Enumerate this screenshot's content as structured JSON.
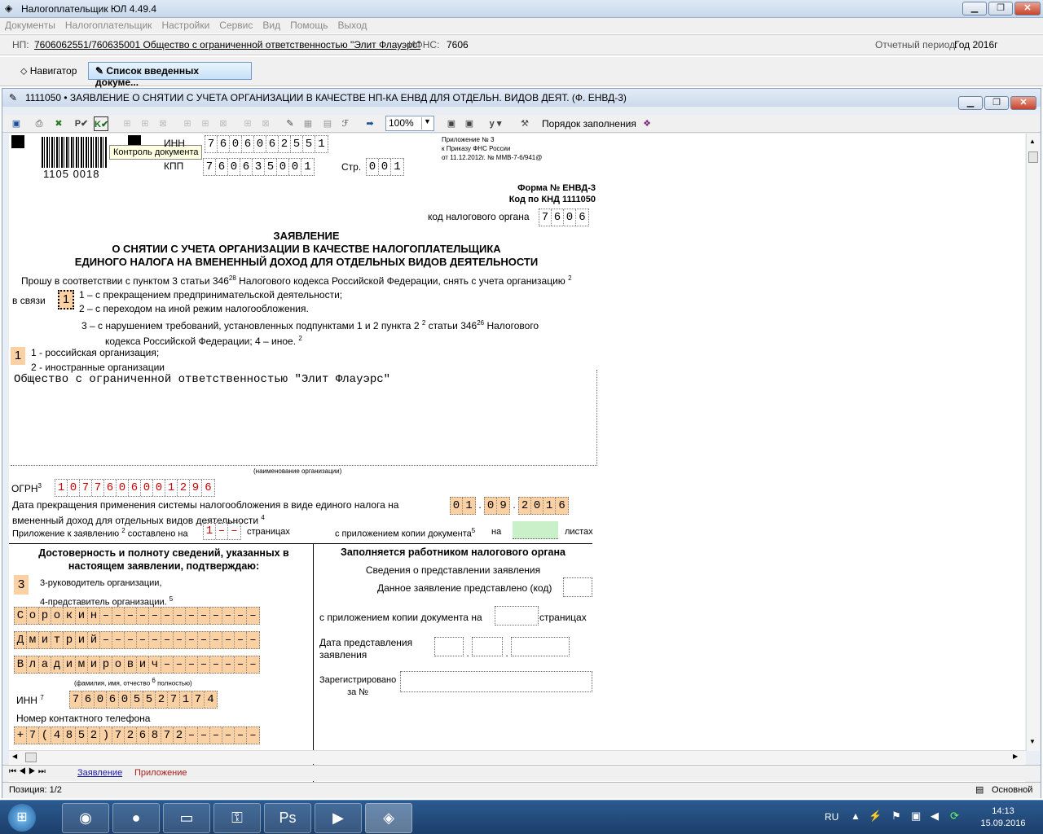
{
  "app": {
    "title": "Налогоплательщик ЮЛ 4.49.4"
  },
  "menu": [
    "Документы",
    "Налогоплательщик",
    "Настройки",
    "Сервис",
    "Вид",
    "Помощь",
    "Выход"
  ],
  "np": {
    "label": "НП:",
    "value": "7606062551/760635001 Общество с ограниченной ответственностью \"Элит Флауэрс\"",
    "ifns_label": "ИФНС:",
    "ifns_value": "7606",
    "period_label": "Отчетный период:",
    "period_value": "Год  2016г"
  },
  "tabs": {
    "navigator": "Навигатор",
    "list": "Список введенных докуме..."
  },
  "doc": {
    "title": "1111050 • ЗАЯВЛЕНИЕ О СНЯТИИ С УЧЕТА ОРГАНИЗАЦИИ В КАЧЕСТВЕ НП-КА ЕНВД ДЛЯ ОТДЕЛЬН. ВИДОВ ДЕЯТ. (Ф. ЕНВД-3)"
  },
  "toolbar": {
    "zoom": "100%",
    "order": "Порядок заполнения",
    "tooltip": "Контроль документа"
  },
  "form": {
    "barcode": "1105 0018",
    "inn_label": "ИНН",
    "inn": [
      "7",
      "6",
      "0",
      "6",
      "0",
      "6",
      "2",
      "5",
      "5",
      "1"
    ],
    "kpp_label": "КПП",
    "kpp": [
      "7",
      "6",
      "0",
      "6",
      "3",
      "5",
      "0",
      "0",
      "1"
    ],
    "page_label": "Стр.",
    "page": [
      "0",
      "0",
      "1"
    ],
    "annex1": "Приложение № 3",
    "annex2": "к Приказу ФНС России",
    "annex3": "от 11.12.2012г. № ММВ-7-6/941@",
    "form_no": "Форма № ЕНВД-3",
    "knd": "Код по КНД 1111050",
    "tax_code_label": "код налогового органа",
    "tax_code": [
      "7",
      "6",
      "0",
      "6"
    ],
    "h1": "ЗАЯВЛЕНИЕ",
    "h2": "О СНЯТИИ С УЧЕТА ОРГАНИЗАЦИИ В КАЧЕСТВЕ НАЛОГОПЛАТЕЛЬЩИКА",
    "h3": "ЕДИНОГО НАЛОГА НА ВМЕНЕННЫЙ ДОХОД ДЛЯ ОТДЕЛЬНЫХ ВИДОВ ДЕЯТЕЛЬНОСТИ",
    "ask": "Прошу в соответствии с пунктом 3 статьи 346",
    "ask_sup": "28",
    "ask2": "Налогового кодекса Российской Федерации, снять с учета организацию",
    "ask_sup2": "2",
    "reason_label": "в связи",
    "reason_value": "1",
    "r1": "1 – с прекращением предпринимательской деятельности;",
    "r2": "2 – с переходом на иной режим налогообложения.",
    "r3": "3 – с нарушением требований, установленных подпунктами 1 и 2 пункта 2",
    "r3_sup": "2",
    "r3b": "статьи 346",
    "r3b_sup": "26",
    "r3c": "Налогового",
    "r4": "кодекса Российской Федерации; 4 – иное.",
    "r4_sup": "2",
    "org_type": "1",
    "o1": "1 - российская организация;",
    "o2": "2 - иностранные организации",
    "org_name": "Общество с ограниченной ответственностью \"Элит Флауэрс\"",
    "org_caption": "(наименование организации)",
    "ogrn_label": "ОГРН",
    "ogrn_sup": "3",
    "ogrn": [
      "1",
      "0",
      "7",
      "7",
      "6",
      "0",
      "6",
      "0",
      "0",
      "1",
      "2",
      "9",
      "6"
    ],
    "date_label1": "Дата прекращения применения системы налогообложения в виде единого налога на",
    "date_label2": "вмененный доход для отдельных видов деятельности",
    "date_sup": "4",
    "date_d": [
      "0",
      "1"
    ],
    "date_m": [
      "0",
      "9"
    ],
    "date_y": [
      "2",
      "0",
      "1",
      "6"
    ],
    "app_label": "Приложение к заявлению",
    "app_sup": "2",
    "app_mid": "составлено на",
    "app_pages": [
      "1",
      "–",
      "–"
    ],
    "app_end": "страницах",
    "copy_label": "с приложением копии документа",
    "copy_sup": "5",
    "copy_on": "на",
    "copy_end": "листах",
    "left_h1": "Достоверность и полноту сведений, указанных в",
    "left_h2": "настоящем заявлении, подтверждаю:",
    "signer": "3",
    "s1": "3-руководитель организации,",
    "s2": "4-представитель организации.",
    "s_sup": "5",
    "surname": [
      "С",
      "о",
      "р",
      "о",
      "к",
      "и",
      "н",
      "–",
      "–",
      "–",
      "–",
      "–",
      "–",
      "–",
      "–",
      "–",
      "–",
      "–",
      "–",
      "–"
    ],
    "name": [
      "Д",
      "м",
      "и",
      "т",
      "р",
      "и",
      "й",
      "–",
      "–",
      "–",
      "–",
      "–",
      "–",
      "–",
      "–",
      "–",
      "–",
      "–",
      "–",
      "–"
    ],
    "patronymic": [
      "В",
      "л",
      "а",
      "д",
      "и",
      "м",
      "и",
      "р",
      "о",
      "в",
      "и",
      "ч",
      "–",
      "–",
      "–",
      "–",
      "–",
      "–",
      "–",
      "–"
    ],
    "fio_caption": "(фамилия, имя, отчество",
    "fio_sup": "6",
    "fio_caption2": "полностью)",
    "inn2_label": "ИНН",
    "inn2_sup": "7",
    "inn2": [
      "7",
      "6",
      "0",
      "6",
      "0",
      "5",
      "5",
      "2",
      "7",
      "1",
      "7",
      "4"
    ],
    "phone_label": "Номер контактного телефона",
    "phone": [
      "+",
      "7",
      "(",
      "4",
      "8",
      "5",
      "2",
      ")",
      "7",
      "2",
      "6",
      "8",
      "7",
      "2",
      "–",
      "–",
      "–",
      "–",
      "–",
      "–"
    ],
    "right_h": "Заполняется работником налогового органа",
    "right_sub": "Сведения о представлении заявления",
    "r_code": "Данное заявление представлено (код)",
    "r_copy": "с приложением копии документа на",
    "r_copy_end": "страницах",
    "r_date1": "Дата представления",
    "r_date2": "заявления",
    "r_reg1": "Зарегистрировано",
    "r_reg2": "за №"
  },
  "sheets": [
    "Заявление",
    "Приложение"
  ],
  "status": {
    "position": "Позиция: 1/2",
    "mode": "Основной"
  },
  "taskbar": {
    "lang": "RU",
    "time": "14:13",
    "date": "15.09.2016"
  }
}
